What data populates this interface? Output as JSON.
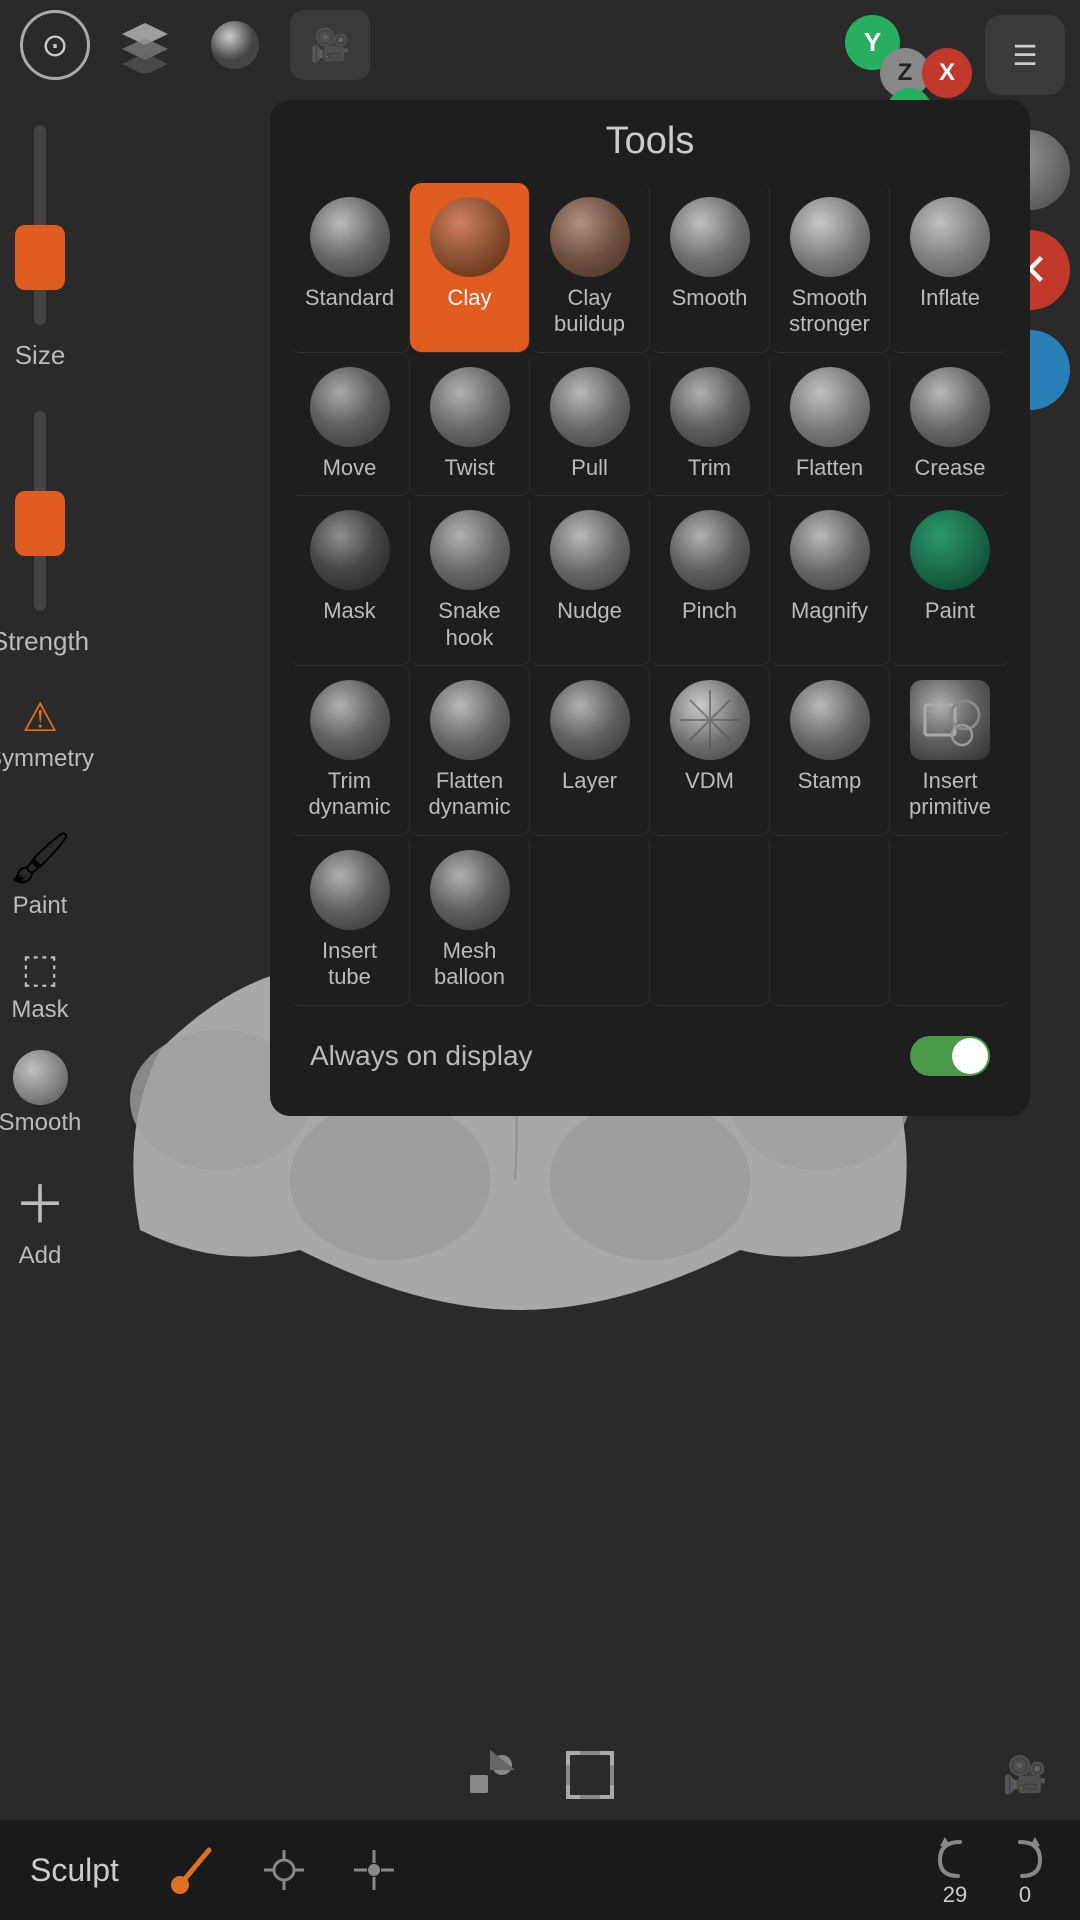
{
  "app": {
    "title": "Sculpt",
    "tools_title": "Tools"
  },
  "topbar": {
    "icons": [
      "⊙",
      "⬡",
      "◉",
      "🎥"
    ]
  },
  "axis": {
    "y_label": "Y",
    "z_label": "Z",
    "x_label": "X"
  },
  "tools": {
    "items": [
      {
        "id": "standard",
        "label": "Standard",
        "active": false,
        "shape": "standard"
      },
      {
        "id": "clay",
        "label": "Clay",
        "active": true,
        "shape": "clay"
      },
      {
        "id": "clay_buildup",
        "label": "Clay buildup",
        "active": false,
        "shape": "claybuildup"
      },
      {
        "id": "smooth",
        "label": "Smooth",
        "active": false,
        "shape": "smooth"
      },
      {
        "id": "smooth_stronger",
        "label": "Smooth stronger",
        "active": false,
        "shape": "smoothstronger"
      },
      {
        "id": "inflate",
        "label": "Inflate",
        "active": false,
        "shape": "inflate"
      },
      {
        "id": "move",
        "label": "Move",
        "active": false,
        "shape": "move"
      },
      {
        "id": "twist",
        "label": "Twist",
        "active": false,
        "shape": "twist"
      },
      {
        "id": "pull",
        "label": "Pull",
        "active": false,
        "shape": "pull"
      },
      {
        "id": "trim",
        "label": "Trim",
        "active": false,
        "shape": "trim"
      },
      {
        "id": "flatten",
        "label": "Flatten",
        "active": false,
        "shape": "flatten"
      },
      {
        "id": "crease",
        "label": "Crease",
        "active": false,
        "shape": "crease"
      },
      {
        "id": "mask",
        "label": "Mask",
        "active": false,
        "shape": "mask"
      },
      {
        "id": "snake_hook",
        "label": "Snake hook",
        "active": false,
        "shape": "snakehook"
      },
      {
        "id": "nudge",
        "label": "Nudge",
        "active": false,
        "shape": "nudge"
      },
      {
        "id": "pinch",
        "label": "Pinch",
        "active": false,
        "shape": "pinch"
      },
      {
        "id": "magnify",
        "label": "Magnify",
        "active": false,
        "shape": "magnify"
      },
      {
        "id": "paint",
        "label": "Paint",
        "active": false,
        "shape": "paint"
      },
      {
        "id": "trim_dynamic",
        "label": "Trim dynamic",
        "active": false,
        "shape": "trimdynamic"
      },
      {
        "id": "flatten_dynamic",
        "label": "Flatten dynamic",
        "active": false,
        "shape": "flattendynamic"
      },
      {
        "id": "layer",
        "label": "Layer",
        "active": false,
        "shape": "layer"
      },
      {
        "id": "vdm",
        "label": "VDM",
        "active": false,
        "shape": "vdm"
      },
      {
        "id": "stamp",
        "label": "Stamp",
        "active": false,
        "shape": "stamp"
      },
      {
        "id": "insert_primitive",
        "label": "Insert primitive",
        "active": false,
        "shape": "insertprimitive"
      },
      {
        "id": "insert_tube",
        "label": "Insert tube",
        "active": false,
        "shape": "inserttube"
      },
      {
        "id": "mesh_balloon",
        "label": "Mesh balloon",
        "active": false,
        "shape": "meshballoon"
      },
      {
        "id": "empty1",
        "label": "",
        "active": false,
        "shape": "empty"
      },
      {
        "id": "empty2",
        "label": "",
        "active": false,
        "shape": "empty"
      },
      {
        "id": "empty3",
        "label": "",
        "active": false,
        "shape": "empty"
      },
      {
        "id": "empty4",
        "label": "",
        "active": false,
        "shape": "empty"
      }
    ]
  },
  "always_display": {
    "label": "Always on display",
    "toggle_on": true
  },
  "left_sidebar": {
    "size_label": "Size",
    "strength_label": "Strength",
    "symmetry_label": "Symmetry",
    "paint_label": "Paint",
    "mask_label": "Mask",
    "smooth_label": "Smooth",
    "add_label": "Add"
  },
  "bottom_bar": {
    "sculpt_label": "Sculpt",
    "undo_count": "29",
    "redo_count": "0"
  }
}
